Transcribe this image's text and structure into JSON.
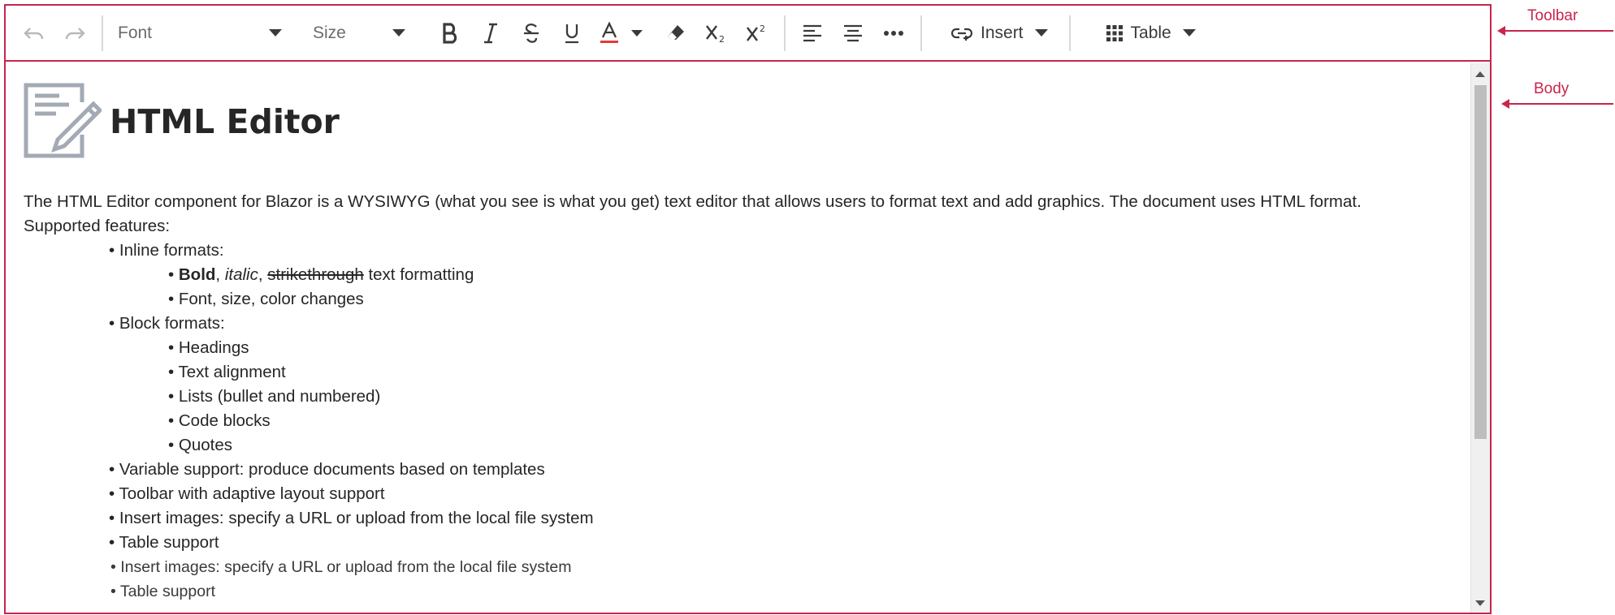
{
  "toolbar": {
    "font_placeholder": "Font",
    "size_placeholder": "Size",
    "insert_label": "Insert",
    "table_label": "Table",
    "icons": [
      "undo-icon",
      "redo-icon",
      "bold-icon",
      "italic-icon",
      "strikethrough-icon",
      "underline-icon",
      "font-color-icon",
      "clear-format-icon",
      "subscript-icon",
      "superscript-icon",
      "align-left-icon",
      "align-center-icon",
      "more-icon",
      "insert-link-icon",
      "table-grid-icon"
    ],
    "font_color_accent": "#e53935"
  },
  "body": {
    "heading": "HTML Editor",
    "intro": "The HTML Editor component for Blazor is a WYSIWYG (what you see is what you get) text editor that allows users to format text and add graphics. The document uses HTML format.",
    "supported": "Supported features:",
    "inline_formats": "Inline formats:",
    "inline_bold": "Bold",
    "inline_sep1": ", ",
    "inline_italic": "italic",
    "inline_sep2": ", ",
    "inline_strike": "strikethrough",
    "inline_tail": " text formatting",
    "inline_font": "Font, size, color changes",
    "block_formats": "Block formats:",
    "block_items": [
      "Headings",
      "Text alignment",
      "Lists (bullet and numbered)",
      "Code blocks",
      "Quotes"
    ],
    "top_items": [
      "Variable support: produce documents based on templates",
      "Toolbar with adaptive layout support",
      "Insert images: specify a URL or upload from the local file system",
      "Table support"
    ],
    "trailing_items": [
      "Insert images: specify a URL or upload from the local file system",
      "Table support"
    ]
  },
  "annotations": {
    "toolbar": "Toolbar",
    "body": "Body"
  },
  "colors": {
    "frame": "#c8254c",
    "scrollbar_thumb": "#bdbdbd"
  }
}
